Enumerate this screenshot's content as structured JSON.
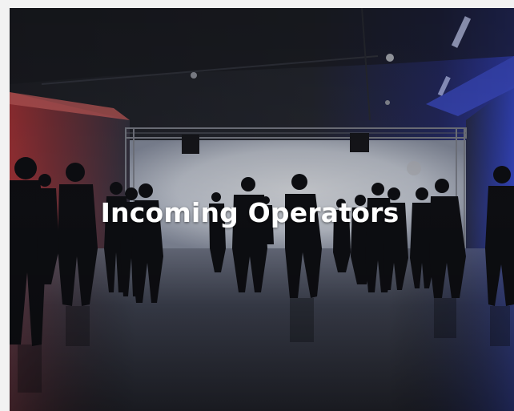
{
  "card": {
    "title": "Incoming Operators",
    "image_subject": "event-hall-crowd-photo"
  },
  "colors": {
    "title_text": "#ffffff",
    "stage_light": "#e8ecf4",
    "left_wash": "#d8484e",
    "right_wash": "#3c4fd6",
    "room_dark": "#141820",
    "page_bg": "#f2f2f2"
  }
}
